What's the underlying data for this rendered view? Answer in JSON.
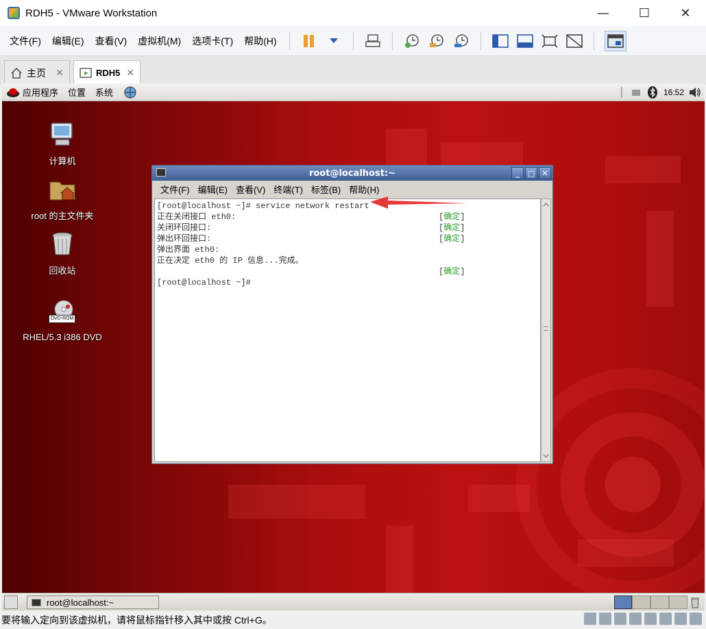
{
  "window": {
    "title": "RDH5 - VMware Workstation",
    "minimize": "—",
    "maximize": "☐",
    "close": "✕"
  },
  "menu": [
    "文件(F)",
    "编辑(E)",
    "查看(V)",
    "虚拟机(M)",
    "选项卡(T)",
    "帮助(H)"
  ],
  "tabs": [
    {
      "label": "主页",
      "close": "✕"
    },
    {
      "label": "RDH5",
      "close": "✕"
    }
  ],
  "guest_panel": {
    "apps": "应用程序",
    "places": "位置",
    "system": "系统",
    "clock": "16:52"
  },
  "desktop_icons": [
    {
      "label": "计算机"
    },
    {
      "label": "root 的主文件夹"
    },
    {
      "label": "回收站"
    },
    {
      "label": "RHEL/5.3 i386 DVD",
      "badge": "DVD-ROM"
    }
  ],
  "terminal": {
    "title": "root@localhost:~",
    "menu": [
      "文件(F)",
      "编辑(E)",
      "查看(V)",
      "终端(T)",
      "标签(B)",
      "帮助(H)"
    ],
    "lines": [
      "[root@localhost ~]# service network restart",
      "正在关闭接口 eth0:",
      "关闭环回接口:",
      "弹出环回接口:",
      "弹出界面 eth0:",
      "正在决定 eth0 的 IP 信息...完成。",
      "",
      "[root@localhost ~]#"
    ],
    "ok_label": "确定",
    "ok_bracket_open": "[",
    "ok_bracket_close": "]"
  },
  "taskbar": {
    "task": "root@localhost:~"
  },
  "statusbar": {
    "text": "要将输入定向到该虚拟机，请将鼠标指针移入其中或按 Ctrl+G。"
  },
  "colors": {
    "annotation_arrow": "#e8363a",
    "ok_green": "#2f9c2f"
  }
}
